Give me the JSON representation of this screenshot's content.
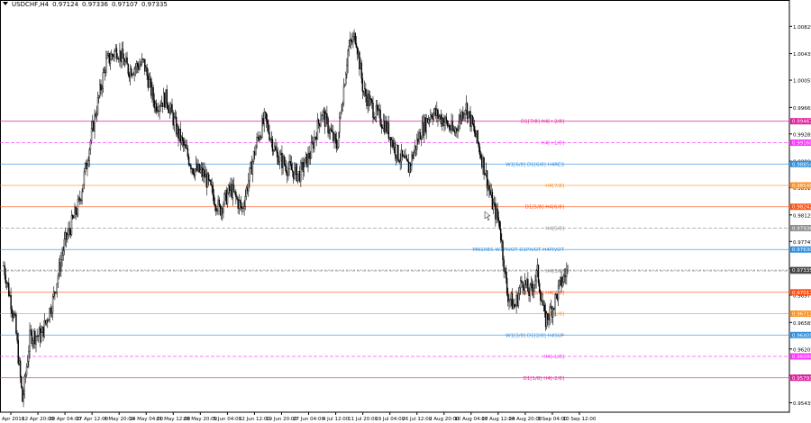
{
  "header": {
    "symbol": "USDCHF,H4",
    "open": "0.97124",
    "high": "0.97336",
    "low": "0.97107",
    "close": "0.97335"
  },
  "chart_data": {
    "type": "candlestick",
    "symbol": "USDCHF",
    "timeframe": "H4",
    "ylim": [
      0.953,
      1.011
    ],
    "price_axis_ticks": [
      "1.00825",
      "1.00435",
      "1.00055",
      "0.99665",
      "0.99285",
      "0.98895",
      "0.98515",
      "0.98125",
      "0.97745",
      "0.97355",
      "0.96975",
      "0.96585",
      "0.96205",
      "0.95825",
      "0.95435",
      "0.95055"
    ],
    "time_labels": [
      "5 Apr 2018",
      "12 Apr 20:00",
      "20 Apr 04:00",
      "27 Apr 12:00",
      "4 May 20:00",
      "14 May 04:00",
      "21 May 12:00",
      "28 May 20:00",
      "5 Jun 04:00",
      "12 Jun 12:00",
      "19 Jun 20:00",
      "27 Jun 04:00",
      "4 Jul 12:00",
      "11 Jul 20:00",
      "19 Jul 04:00",
      "26 Jul 12:00",
      "2 Aug 20:00",
      "10 Aug 04:00",
      "17 Aug 12:00",
      "24 Aug 20:00",
      "3 Sep 04:00",
      "10 Sep 12:00"
    ],
    "price_path": [
      [
        0,
        0.974
      ],
      [
        0.015,
        0.966
      ],
      [
        0.025,
        0.9545
      ],
      [
        0.035,
        0.964
      ],
      [
        0.05,
        0.964
      ],
      [
        0.065,
        0.969
      ],
      [
        0.08,
        0.977
      ],
      [
        0.1,
        0.983
      ],
      [
        0.12,
        0.995
      ],
      [
        0.135,
        1.003
      ],
      [
        0.15,
        1.005
      ],
      [
        0.165,
        1.002
      ],
      [
        0.185,
        1.003
      ],
      [
        0.2,
        0.997
      ],
      [
        0.215,
        0.998
      ],
      [
        0.23,
        0.993
      ],
      [
        0.25,
        0.988
      ],
      [
        0.265,
        0.987
      ],
      [
        0.285,
        0.982
      ],
      [
        0.3,
        0.985
      ],
      [
        0.315,
        0.982
      ],
      [
        0.335,
        0.992
      ],
      [
        0.345,
        0.995
      ],
      [
        0.36,
        0.99
      ],
      [
        0.375,
        0.988
      ],
      [
        0.39,
        0.987
      ],
      [
        0.405,
        0.99
      ],
      [
        0.42,
        0.996
      ],
      [
        0.44,
        0.991
      ],
      [
        0.455,
        1.005
      ],
      [
        0.465,
        1.007
      ],
      [
        0.475,
        0.999
      ],
      [
        0.49,
        0.996
      ],
      [
        0.505,
        0.994
      ],
      [
        0.52,
        0.99
      ],
      [
        0.535,
        0.988
      ],
      [
        0.55,
        0.993
      ],
      [
        0.565,
        0.996
      ],
      [
        0.58,
        0.995
      ],
      [
        0.595,
        0.993
      ],
      [
        0.61,
        0.997
      ],
      [
        0.625,
        0.992
      ],
      [
        0.635,
        0.988
      ],
      [
        0.645,
        0.983
      ],
      [
        0.655,
        0.98
      ],
      [
        0.665,
        0.97
      ],
      [
        0.675,
        0.968
      ],
      [
        0.685,
        0.972
      ],
      [
        0.695,
        0.97
      ],
      [
        0.705,
        0.973
      ],
      [
        0.715,
        0.966
      ],
      [
        0.725,
        0.968
      ],
      [
        0.735,
        0.9712
      ],
      [
        0.745,
        0.9734
      ]
    ],
    "levels": [
      {
        "price": 0.99467,
        "label": "D1[7/8] H4[+2/8]",
        "axis_label": "0.99467",
        "color": "#e020a0",
        "style": "solid"
      },
      {
        "price": 0.9916,
        "label": "H4[+1/8]",
        "axis_label": "0.99160",
        "color": "#ff30ff",
        "style": "dash"
      },
      {
        "price": 0.98854,
        "label": "W1[6/8] D1[6/8] H4RES",
        "axis_label": "0.98854",
        "color": "#3090e0",
        "style": "solid"
      },
      {
        "price": 0.98548,
        "label": "H4[7/8]",
        "axis_label": "0.98548",
        "color": "#ff9020",
        "style": "solid"
      },
      {
        "price": 0.98242,
        "label": "D1[5/8] H4[6/8]",
        "axis_label": "0.98242",
        "color": "#ff5010",
        "style": "solid"
      },
      {
        "price": 0.97936,
        "label": "H4[5/8]",
        "axis_label": "0.97936",
        "color": "#909090",
        "style": "dash"
      },
      {
        "price": 0.9763,
        "label": "MN1RES W1PIVOT D1PIVOT H4PIVOT",
        "axis_label": "0.97630",
        "color": "#3090e0",
        "style": "solid"
      },
      {
        "price": 0.97324,
        "label": "H4[3/8]",
        "axis_label": "0.97324",
        "color": "#909090",
        "style": "dash"
      },
      {
        "price": 0.97017,
        "label": "D1[3/8] H4[2/8]",
        "axis_label": "0.97017",
        "color": "#ff5010",
        "style": "solid"
      },
      {
        "price": 0.96711,
        "label": "H4[1/8]",
        "axis_label": "0.96711",
        "color": "#ff9020",
        "style": "solid"
      },
      {
        "price": 0.96405,
        "label": "W1[2/8] D1[2/8] H4SUP",
        "axis_label": "0.96405",
        "color": "#3090e0",
        "style": "solid"
      },
      {
        "price": 0.96099,
        "label": "H4[-1/8]",
        "axis_label": "0.96099",
        "color": "#ff30ff",
        "style": "dash"
      },
      {
        "price": 0.95793,
        "label": "D1[1/8] H4[-2/8]",
        "axis_label": "0.95793",
        "color": "#e020a0",
        "style": "solid"
      }
    ],
    "current_price": {
      "value": 0.97335,
      "axis_label": "0.97335",
      "color": "#404040"
    }
  }
}
